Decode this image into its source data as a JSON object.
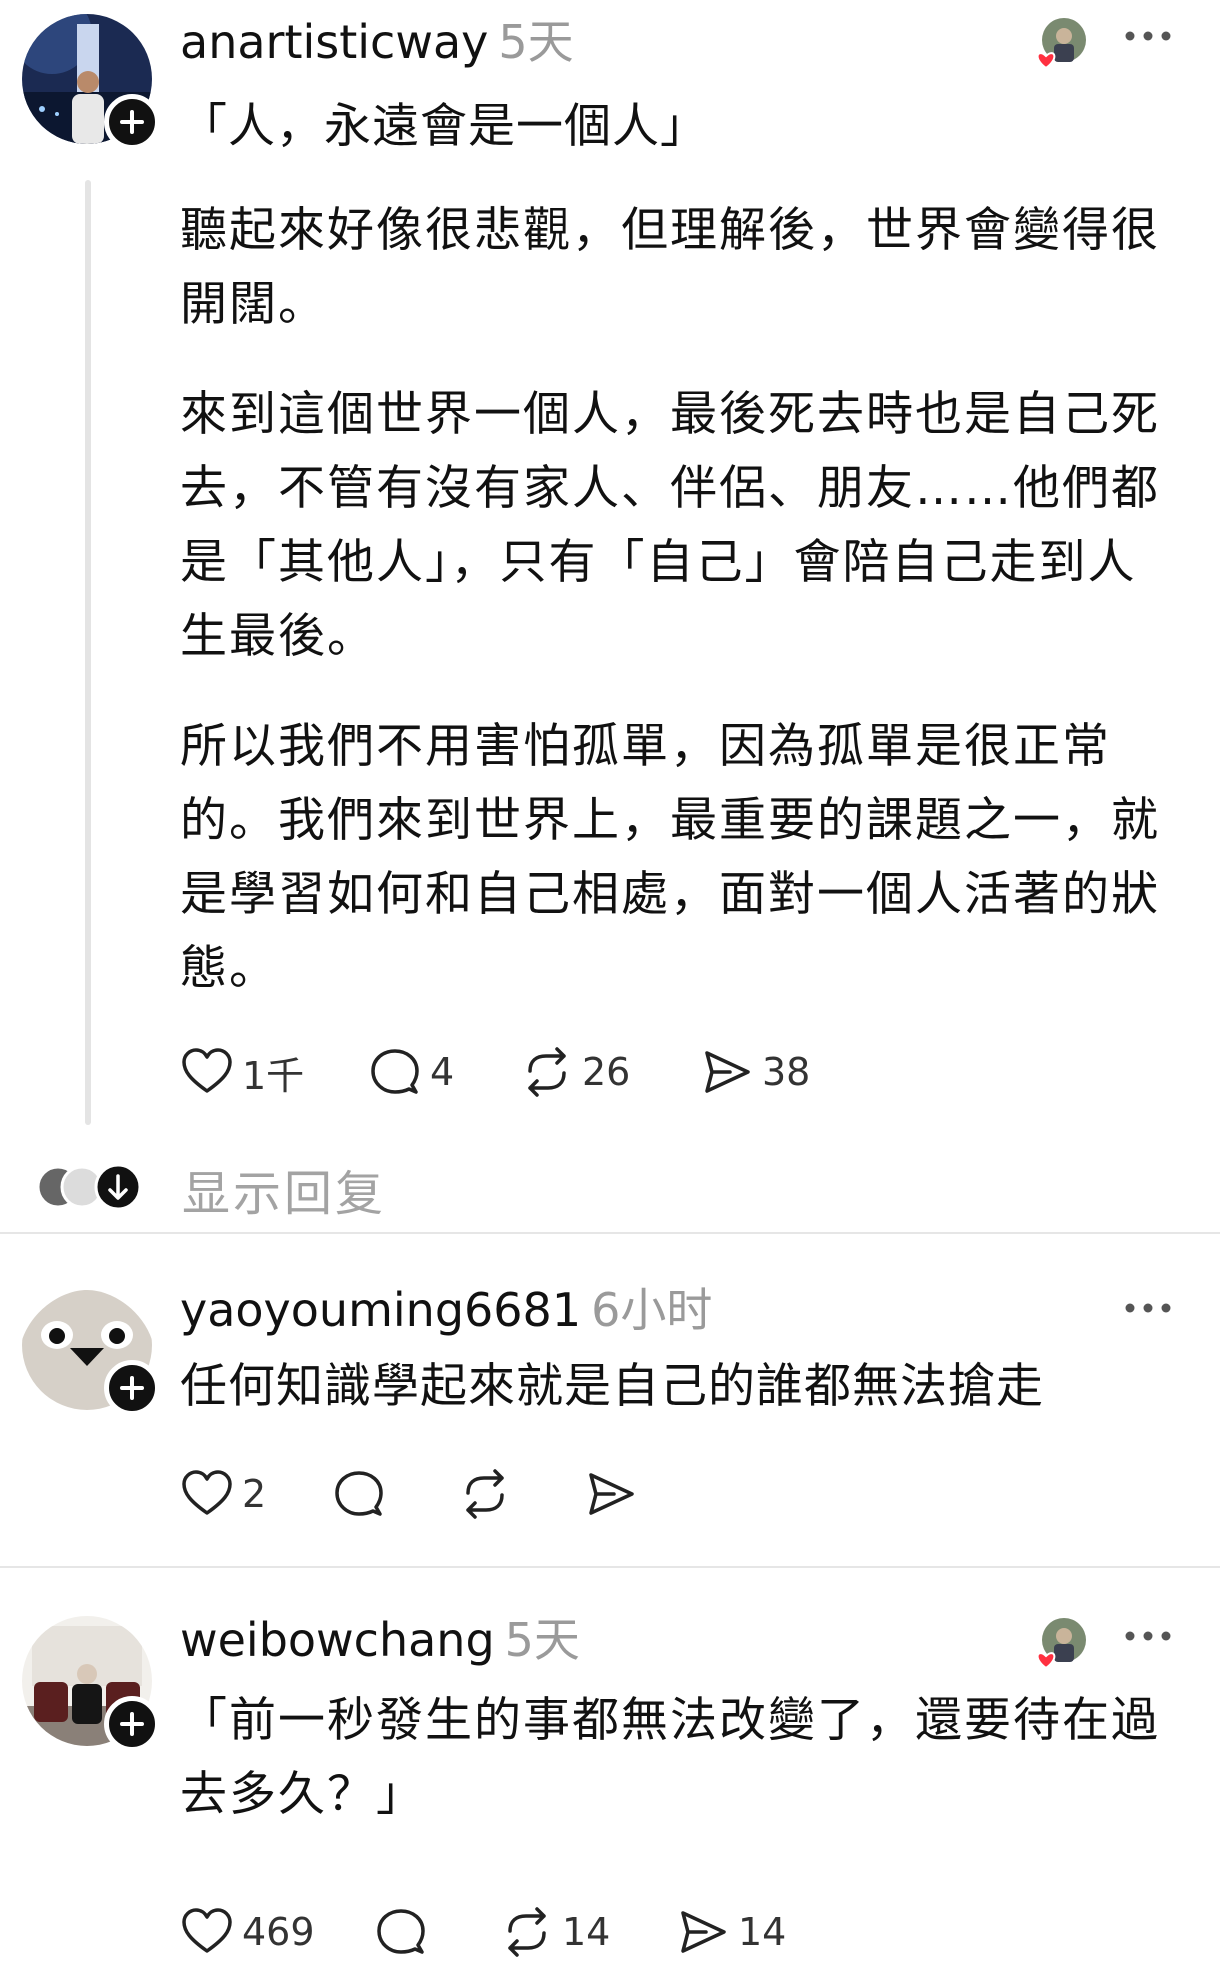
{
  "posts": [
    {
      "username": "anartisticway",
      "time": "5天",
      "paragraphs": [
        "「人，永遠會是一個人」",
        "聽起來好像很悲觀，但理解後，世界會變得很開闊。",
        "來到這個世界一個人，最後死去時也是自己死去，不管有沒有家人、伴侶、朋友……他們都是「其他人」，只有「自己」會陪自己走到人生最後。",
        "所以我們不用害怕孤單，因為孤單是很正常的。我們來到世界上，最重要的課題之一，就是學習如何和自己相處，面對一個人活著的狀態。"
      ],
      "likes": "1千",
      "replies": "4",
      "reposts": "26",
      "shares": "38",
      "show_replies_label": "显示回复"
    },
    {
      "username": "yaoyouming6681",
      "time": "6小时",
      "paragraphs": [
        "任何知識學起來就是自己的誰都無法搶走"
      ],
      "likes": "2"
    },
    {
      "username": "weibowchang",
      "time": "5天",
      "paragraphs": [
        "「前一秒發生的事都無法改變了，還要待在過去多久？」"
      ],
      "likes": "469",
      "reposts": "14",
      "shares": "14"
    }
  ],
  "icons": {
    "like": "heart-icon",
    "reply": "speech-bubble-icon",
    "repost": "repost-icon",
    "share": "send-icon",
    "more": "more-dots-icon",
    "follow": "plus-icon",
    "expand": "arrow-down-icon"
  },
  "colors": {
    "accent_heart": "#ff3040",
    "muted_text": "#9a9a9a"
  }
}
